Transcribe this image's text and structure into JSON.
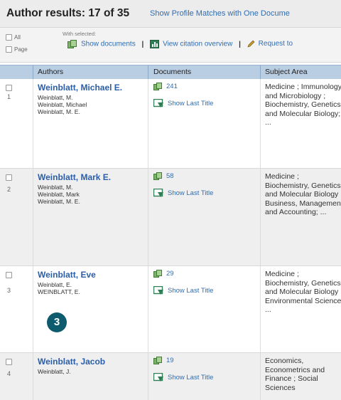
{
  "header": {
    "title": "Author results: 17 of 35",
    "profile_link": "Show Profile Matches with One Docume"
  },
  "toolbar": {
    "all_label": "All",
    "page_label": "Page",
    "with_selected": "With selected:",
    "show_documents": "Show documents",
    "view_citation": "View citation overview",
    "request": "Request to",
    "separator": "|"
  },
  "table": {
    "columns": [
      "Authors",
      "Documents",
      "Subject Area"
    ],
    "show_last_title": "Show Last Title",
    "rows": [
      {
        "num": "1",
        "name": "Weinblatt, Michael E.",
        "variants": [
          "Weinblatt, M.",
          "Weinblatt, Michael",
          "Weinblatt, M. E."
        ],
        "documents": "241",
        "subject": "Medicine ; Immunology and Microbiology ; Biochemistry, Genetics and Molecular Biology; ..."
      },
      {
        "num": "2",
        "name": "Weinblatt, Mark E.",
        "variants": [
          "Weinblatt, M.",
          "Weinblatt, Mark",
          "Weinblatt, M. E."
        ],
        "documents": "58",
        "subject": "Medicine ; Biochemistry, Genetics and Molecular Biology ; Business, Management and Accounting; ..."
      },
      {
        "num": "3",
        "name": "Weinblatt, Eve",
        "variants": [
          "Weinblatt, E.",
          "WEINBLATT, E."
        ],
        "documents": "29",
        "subject": "Medicine ; Biochemistry, Genetics and Molecular Biology ; Environmental Science; ..."
      },
      {
        "num": "4",
        "name": "Weinblatt, Jacob",
        "variants": [
          "Weinblatt, J."
        ],
        "documents": "19",
        "subject": "Economics, Econometrics and Finance ; Social Sciences"
      }
    ]
  },
  "callout": "3",
  "colors": {
    "link": "#2f6db3",
    "header_row": "#b9cde3",
    "callout": "#0e5b6e"
  }
}
